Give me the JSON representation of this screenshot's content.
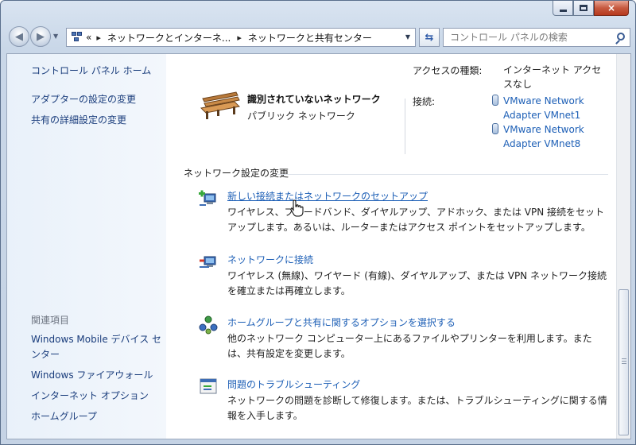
{
  "window": {
    "controls": {
      "minimize": "minimize-icon",
      "maximize": "maximize-icon",
      "close": "×"
    }
  },
  "address": {
    "overflow": "«",
    "crumbs": [
      "ネットワークとインターネ...",
      "ネットワークと共有センター"
    ],
    "separator": "▸"
  },
  "search": {
    "placeholder": "コントロール パネルの検索"
  },
  "sidebar": {
    "home": "コントロール パネル ホーム",
    "links": [
      "アダプターの設定の変更",
      "共有の詳細設定の変更"
    ],
    "related_title": "関連項目",
    "related": [
      "Windows Mobile デバイス センター",
      "Windows ファイアウォール",
      "インターネット オプション",
      "ホームグループ"
    ]
  },
  "network": {
    "name": "識別されていないネットワーク",
    "type": "パブリック ネットワーク",
    "access_label": "アクセスの種類:",
    "access_value": "インターネット アクセスなし",
    "connections_label": "接続:",
    "connections": [
      "VMware Network Adapter VMnet1",
      "VMware Network Adapter VMnet8"
    ]
  },
  "settings": {
    "section_title": "ネットワーク設定の変更",
    "tasks": [
      {
        "title": "新しい接続またはネットワークのセットアップ",
        "desc": "ワイヤレス、ブロードバンド、ダイヤルアップ、アドホック、または VPN 接続をセットアップします。あるいは、ルーターまたはアクセス ポイントをセットアップします。",
        "icon": "network-setup-icon"
      },
      {
        "title": "ネットワークに接続",
        "desc": "ワイヤレス (無線)、ワイヤード (有線)、ダイヤルアップ、または VPN ネットワーク接続を確立または再確立します。",
        "icon": "network-connect-icon"
      },
      {
        "title": "ホームグループと共有に関するオプションを選択する",
        "desc": "他のネットワーク コンピューター上にあるファイルやプリンターを利用します。または、共有設定を変更します。",
        "icon": "homegroup-icon"
      },
      {
        "title": "問題のトラブルシューティング",
        "desc": "ネットワークの問題を診断して修復します。または、トラブルシューティングに関する情報を入手します。",
        "icon": "troubleshoot-icon"
      }
    ]
  },
  "colors": {
    "link": "#1d5fb6",
    "sidebar_link": "#1a3d7c",
    "sidebar_bg": "#e9f1fa"
  }
}
